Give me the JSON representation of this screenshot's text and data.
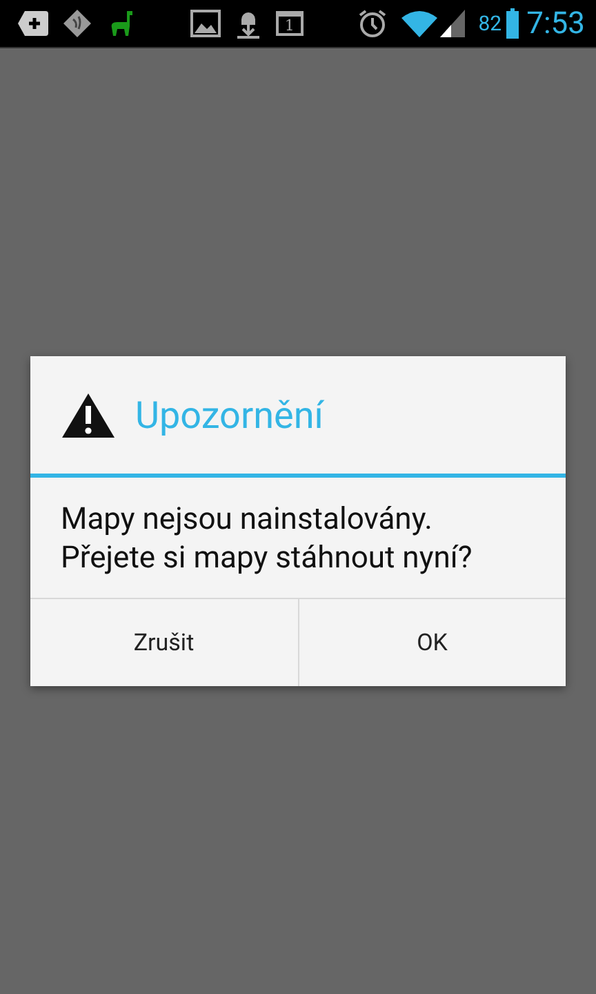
{
  "status_bar": {
    "calendar_day": "1",
    "battery": "82",
    "time": "7:53"
  },
  "dialog": {
    "title": "Upozornění",
    "message_lines": [
      "Mapy nejsou nainstalovány.",
      "Přejete si mapy stáhnout nyní?"
    ],
    "buttons": [
      {
        "label": "Zrušit"
      },
      {
        "label": "OK"
      }
    ]
  }
}
